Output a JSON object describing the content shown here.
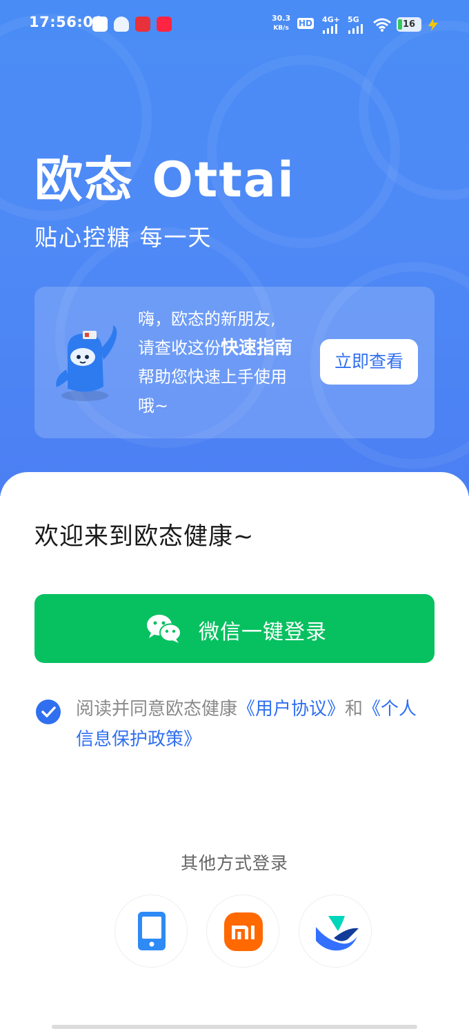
{
  "status_bar": {
    "time": "17:56:00",
    "net_speed": "30.3",
    "net_speed_unit": "KB/s",
    "hd_label": "HD",
    "sim1_label": "4G+",
    "sim2_label": "5G",
    "battery": "16"
  },
  "hero": {
    "brand": "欧态 Ottai",
    "tagline": "贴心控糖  每一天"
  },
  "guide_card": {
    "line1": "嗨，欧态的新朋友,",
    "line2_prefix": "请查收这份",
    "line2_bold": "快速指南",
    "line3": "帮助您快速上手使用",
    "line4": "哦~",
    "button_label": "立即查看"
  },
  "login": {
    "welcome": "欢迎来到欧态健康~",
    "wechat_label": "微信一键登录",
    "agreement_prefix": "阅读并同意欧态健康",
    "agreement_link1": "《用户协议》",
    "agreement_and": "和",
    "agreement_link2": "《个人信息保护政策》",
    "other_title": "其他方式登录"
  },
  "colors": {
    "primary": "#2f6ff0",
    "wechat_green": "#07c160",
    "hero_blue": "#4a8cf5"
  },
  "icons": [
    "phone-login-icon",
    "xiaomi-login-icon",
    "feishu-login-icon"
  ]
}
